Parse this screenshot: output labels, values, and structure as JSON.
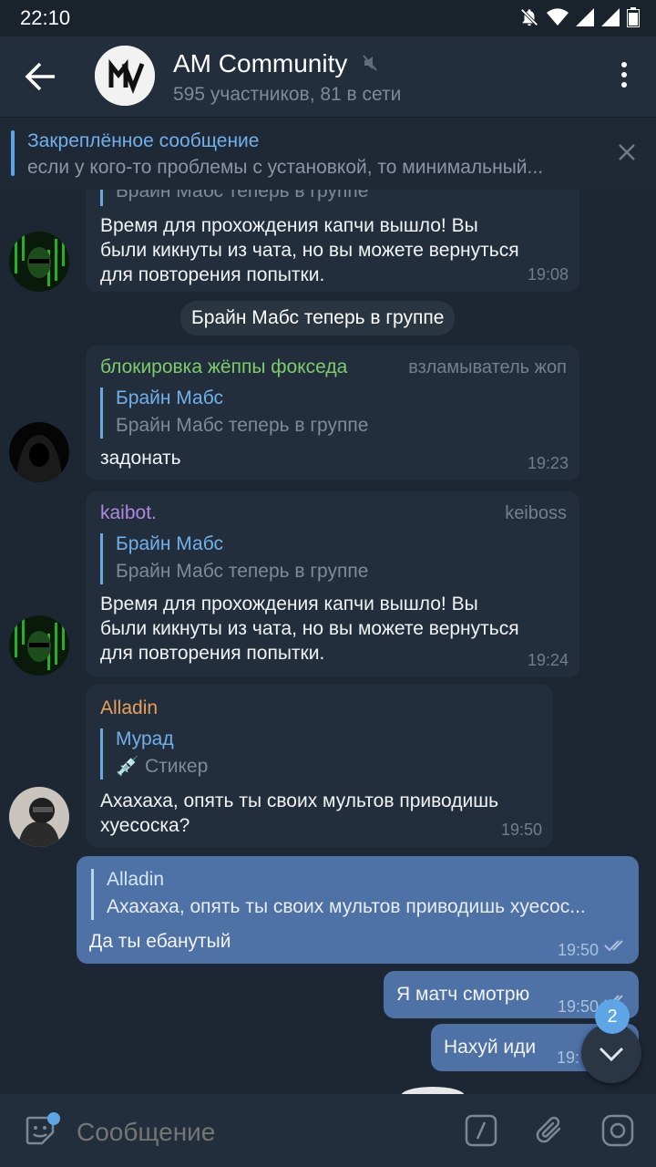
{
  "status_bar": {
    "time": "22:10"
  },
  "header": {
    "title": "AM Community",
    "subtitle": "595 участников, 81 в сети"
  },
  "pinned": {
    "label": "Закреплённое сообщение",
    "text": "если у кого-то проблемы с установкой, то минимальный..."
  },
  "messages": {
    "m1": {
      "reply_text": "Брайн Мабс теперь в группе",
      "text_lines": [
        "Время для прохождения капчи вышло! Вы",
        "были кикнуты из чата, но вы можете вернуться",
        "для повторения попытки."
      ],
      "time": "19:08"
    },
    "service": "Брайн Мабс теперь в группе",
    "m2": {
      "author": "блокировка жёппы фокседа",
      "role": "взламыватель жоп",
      "reply_name": "Брайн Мабс",
      "reply_text": "Брайн Мабс теперь в группе",
      "text": "задонать",
      "time": "19:23"
    },
    "m3": {
      "author": "kaibot.",
      "role": "keiboss",
      "reply_name": "Брайн Мабс",
      "reply_text": "Брайн Мабс теперь в группе",
      "text_lines": [
        "Время для прохождения капчи вышло! Вы",
        "были кикнуты из чата, но вы можете вернуться",
        "для повторения попытки."
      ],
      "time": "19:24"
    },
    "m4": {
      "author": "Alladin",
      "reply_name": "Мурад",
      "reply_text": "💉 Стикер",
      "text_lines": [
        "Ахахаха, опять ты своих мультов приводишь",
        "хуесоска?"
      ],
      "time": "19:50"
    },
    "m5": {
      "reply_name": "Alladin",
      "reply_text": "Ахахаха, опять ты своих мультов приводишь хуесос...",
      "text": "Да ты ебанутый",
      "time": "19:50"
    },
    "m6": {
      "text": "Я матч смотрю",
      "time": "19:50"
    },
    "m7": {
      "text": "Нахуй иди",
      "time": "19:"
    }
  },
  "scroll_badge": "2",
  "composer": {
    "placeholder": "Сообщение"
  },
  "colors": {
    "background": "#1d2733",
    "header": "#232e3c",
    "bubble_in": "#232e3c",
    "bubble_out": "#4e71a6",
    "accent": "#5ea5e7",
    "author_green": "#7dcb6a",
    "author_purple": "#b088e0",
    "author_orange": "#e8a05c"
  }
}
